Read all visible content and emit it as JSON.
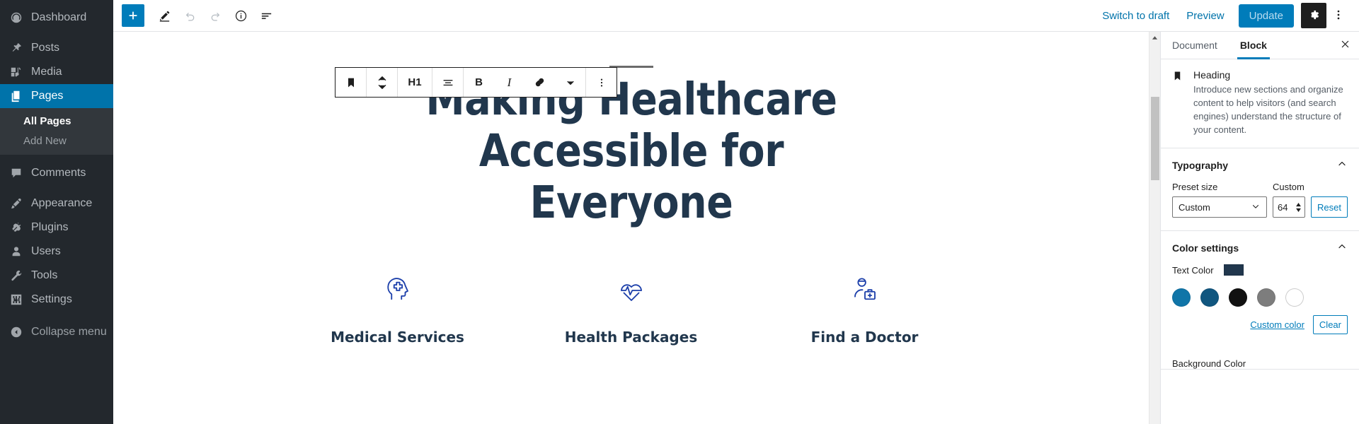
{
  "admin_sidebar": {
    "items": [
      {
        "label": "Dashboard",
        "icon": "dashboard-icon",
        "state": "normal"
      },
      {
        "label": "Posts",
        "icon": "pin-icon",
        "state": "normal"
      },
      {
        "label": "Media",
        "icon": "media-icon",
        "state": "normal"
      },
      {
        "label": "Pages",
        "icon": "pages-icon",
        "state": "current"
      },
      {
        "label": "Comments",
        "icon": "comment-icon",
        "state": "normal"
      },
      {
        "label": "Appearance",
        "icon": "brush-icon",
        "state": "normal"
      },
      {
        "label": "Plugins",
        "icon": "plugin-icon",
        "state": "normal"
      },
      {
        "label": "Users",
        "icon": "user-icon",
        "state": "normal"
      },
      {
        "label": "Tools",
        "icon": "wrench-icon",
        "state": "normal"
      },
      {
        "label": "Settings",
        "icon": "settings-icon",
        "state": "normal"
      }
    ],
    "submenu": [
      {
        "label": "All Pages",
        "active": true
      },
      {
        "label": "Add New",
        "active": false
      }
    ],
    "collapse": {
      "label": "Collapse menu",
      "icon": "collapse-arrow-icon"
    },
    "highlight_color": "#0073aa",
    "background_color": "#23282d"
  },
  "header": {
    "left_tools": [
      {
        "name": "add-block-button",
        "icon": "plus-icon"
      },
      {
        "name": "edit-mode-button",
        "icon": "pencil-icon"
      },
      {
        "name": "undo-button",
        "icon": "undo-icon"
      },
      {
        "name": "redo-button",
        "icon": "redo-icon"
      },
      {
        "name": "details-button",
        "icon": "info-icon"
      },
      {
        "name": "list-view-button",
        "icon": "list-view-icon"
      }
    ],
    "switch_to_draft": "Switch to draft",
    "preview": "Preview",
    "update": "Update",
    "settings_icon": "gear-icon",
    "more_icon": "vertical-dots-icon",
    "accent_color": "#007cba"
  },
  "block_toolbar": {
    "items": [
      {
        "name": "block-type-button",
        "icon": "heading-bookmark-icon",
        "label": ""
      },
      {
        "name": "move-up-down-button",
        "icon": "chevron-up-down-icon",
        "label": ""
      },
      {
        "name": "heading-level-button",
        "icon": "",
        "label": "H1"
      },
      {
        "name": "align-text-button",
        "icon": "align-icon",
        "label": ""
      },
      {
        "name": "bold-button",
        "icon": "",
        "label": "B"
      },
      {
        "name": "italic-button",
        "icon": "",
        "label": "I"
      },
      {
        "name": "link-button",
        "icon": "link-icon",
        "label": ""
      },
      {
        "name": "more-rich-text-button",
        "icon": "chevron-down-icon",
        "label": ""
      },
      {
        "name": "block-options-button",
        "icon": "vertical-dots-icon",
        "label": ""
      }
    ]
  },
  "canvas": {
    "heading": "Making Healthcare Accessible for Everyone",
    "heading_color": "#21374d",
    "features": [
      {
        "label": "Medical Services",
        "icon": "head-medical-cross-icon"
      },
      {
        "label": "Health Packages",
        "icon": "heart-pulse-icon"
      },
      {
        "label": "Find a Doctor",
        "icon": "doctor-medical-bag-icon"
      }
    ],
    "icon_color": "#1c3faa"
  },
  "inspector": {
    "tabs": [
      {
        "label": "Document",
        "active": false
      },
      {
        "label": "Block",
        "active": true
      }
    ],
    "close_icon": "close-icon",
    "block_card": {
      "icon": "heading-bookmark-icon",
      "title": "Heading",
      "description": "Introduce new sections and organize content to help visitors (and search engines) understand the structure of your content."
    },
    "typography": {
      "title": "Typography",
      "collapse_icon": "chevron-up-icon",
      "preset_label": "Preset size",
      "preset_value": "Custom",
      "custom_label": "Custom",
      "custom_value": "64",
      "reset_label": "Reset"
    },
    "color_settings": {
      "title": "Color settings",
      "collapse_icon": "chevron-up-icon",
      "text_color_label": "Text Color",
      "text_color_value": "#21374d",
      "palette": [
        "#1075a8",
        "#11567f",
        "#111111",
        "#7d7d7d",
        "#ffffff"
      ],
      "custom_color_label": "Custom color",
      "clear_label": "Clear",
      "background_color_label": "Background Color"
    }
  }
}
